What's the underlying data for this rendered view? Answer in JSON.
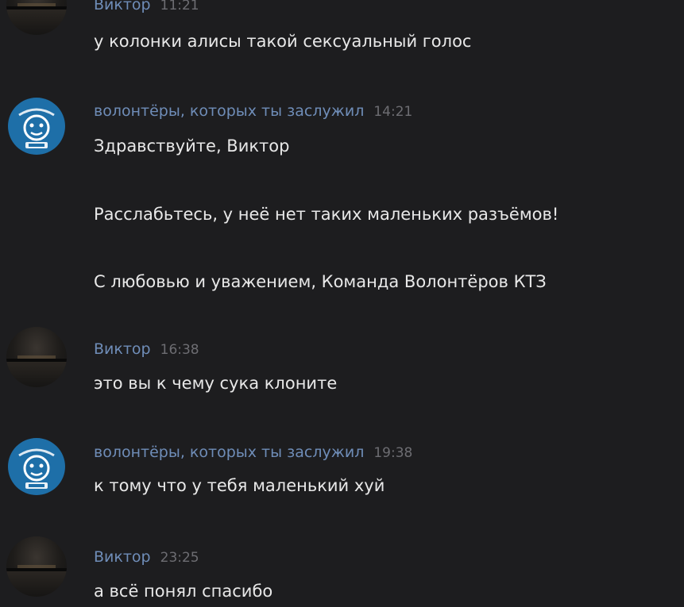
{
  "messages": [
    {
      "sender": "Виктор",
      "time": "11:21",
      "lines": [
        "у колонки алисы такой сексуальный голос"
      ]
    },
    {
      "sender": "волонтёры, которых ты заслужил",
      "time": "14:21",
      "lines": [
        "Здравствуйте, Виктор",
        "Расслабьтесь, у неё нет таких маленьких разъёмов!",
        "С любовью и уважением, Команда Волонтёров КТЗ"
      ]
    },
    {
      "sender": "Виктор",
      "time": "16:38",
      "lines": [
        "это вы к чему сука клоните"
      ]
    },
    {
      "sender": "волонтёры, которых ты заслужил",
      "time": "19:38",
      "lines": [
        "к тому что у тебя маленький хуй"
      ]
    },
    {
      "sender": "Виктор",
      "time": "23:25",
      "lines": [
        "а всё понял спасибо"
      ]
    }
  ],
  "colors": {
    "background": "#1d1d1f",
    "sender_name": "#6f8db8",
    "timestamp": "#6d6d72",
    "message_text": "#e8e8e8",
    "group_avatar": "#1e6fa8"
  },
  "icons": {
    "user_avatar": "night-landscape-avatar-icon",
    "group_avatar": "volunteer-group-logo-icon"
  }
}
